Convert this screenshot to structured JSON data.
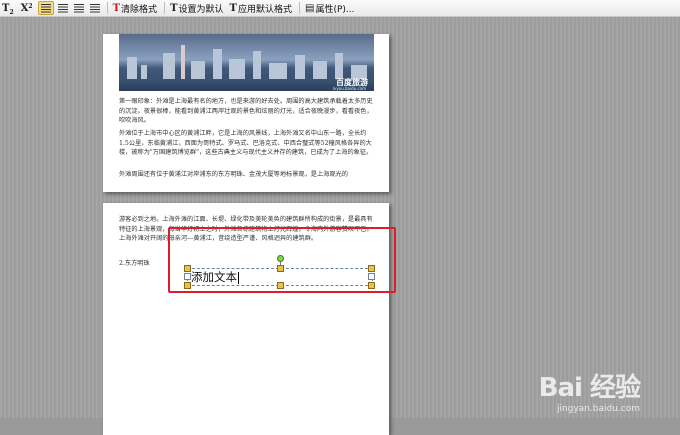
{
  "toolbar": {
    "subscript_icon": "T",
    "subscript_mark": "2",
    "superscript_icon": "X",
    "superscript_mark": "2",
    "clear_format_label": "清除格式",
    "set_default_label": "设置为默认",
    "apply_default_label": "应用默认格式",
    "properties_label": "属性(P)..."
  },
  "photo": {
    "watermark": "百度旅游",
    "watermark_url": "lvyou.baidu.com"
  },
  "page1": {
    "paragraphs": [
      "第一眼印象：外滩是上海最有名的地方，也是来游的好去处。周围的高大建筑承载着太多历史的沉淀。夜景很棒，能看到黄浦江两岸壮观的景色和炫丽的灯光，适合夜晚漫步，看看夜色，吹吹海风。",
      "外滩位于上海市中心区的黄浦江畔，它是上海的风景线，上海外滩又名中山东一路，全长约1.5公里，东临黄浦江，西面为哥特式、罗马式、巴洛克式、中西合璧式等52幢风格各异的大楼，被称为\"万国建筑博览群\"，这些古典主义与现代主义并存的建筑，已成为了上海的象征。",
      "外滩周围还有位于黄浦江对岸浦东的东方明珠、金茂大厦等地标景观，是上海观光的"
    ]
  },
  "page2": {
    "paragraph": "游客必到之地。上海外滩的江面、长堤、绿化带及美轮美奂的建筑群所构成的街景，是最具有特征的上海景观，每当华灯初上之时，外滩各栋建筑物上灯光辉煌，令海内外游客赞叹不已。上海外滩对开阔的母亲河---黄浦江，昔绕造型严谨、风格迥异的建筑群。",
    "list_label": "2.东方明珠",
    "textbox_text": "添加文本"
  },
  "watermark": {
    "brand": "Bai 经验",
    "url": "jingyan.baidu.com"
  },
  "colors": {
    "highlight": "#e01c2a",
    "selection_handle": "#e8c24a",
    "rotate_handle": "#8bd14a",
    "toolbar_active": "#f6dc88"
  }
}
